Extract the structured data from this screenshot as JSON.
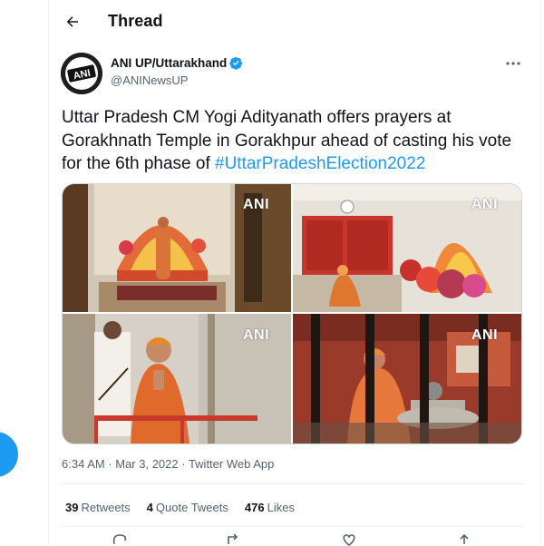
{
  "header": {
    "title": "Thread",
    "back_icon": "arrow-left-icon"
  },
  "tweet": {
    "author_name": "ANI UP/Uttarakhand",
    "author_handle": "@ANINewsUP",
    "verified": true,
    "avatar_text": "ANI",
    "text_plain": "Uttar Pradesh CM Yogi Adityanath offers prayers at Gorakhnath Temple in Gorakhpur ahead of casting his vote for the 6th phase of ",
    "hashtag": "#UttarPradeshElection2022",
    "timestamp": "6:34 AM · Mar 3, 2022 · Twitter Web App",
    "media_watermark": "ANI",
    "media_count": 4
  },
  "stats": {
    "retweets_count": "39",
    "retweets_label": "Retweets",
    "quotes_count": "4",
    "quotes_label": "Quote Tweets",
    "likes_count": "476",
    "likes_label": "Likes"
  },
  "colors": {
    "accent": "#1d9bf0",
    "text": "#0f1419",
    "muted": "#536471",
    "border": "#eff3f4"
  }
}
